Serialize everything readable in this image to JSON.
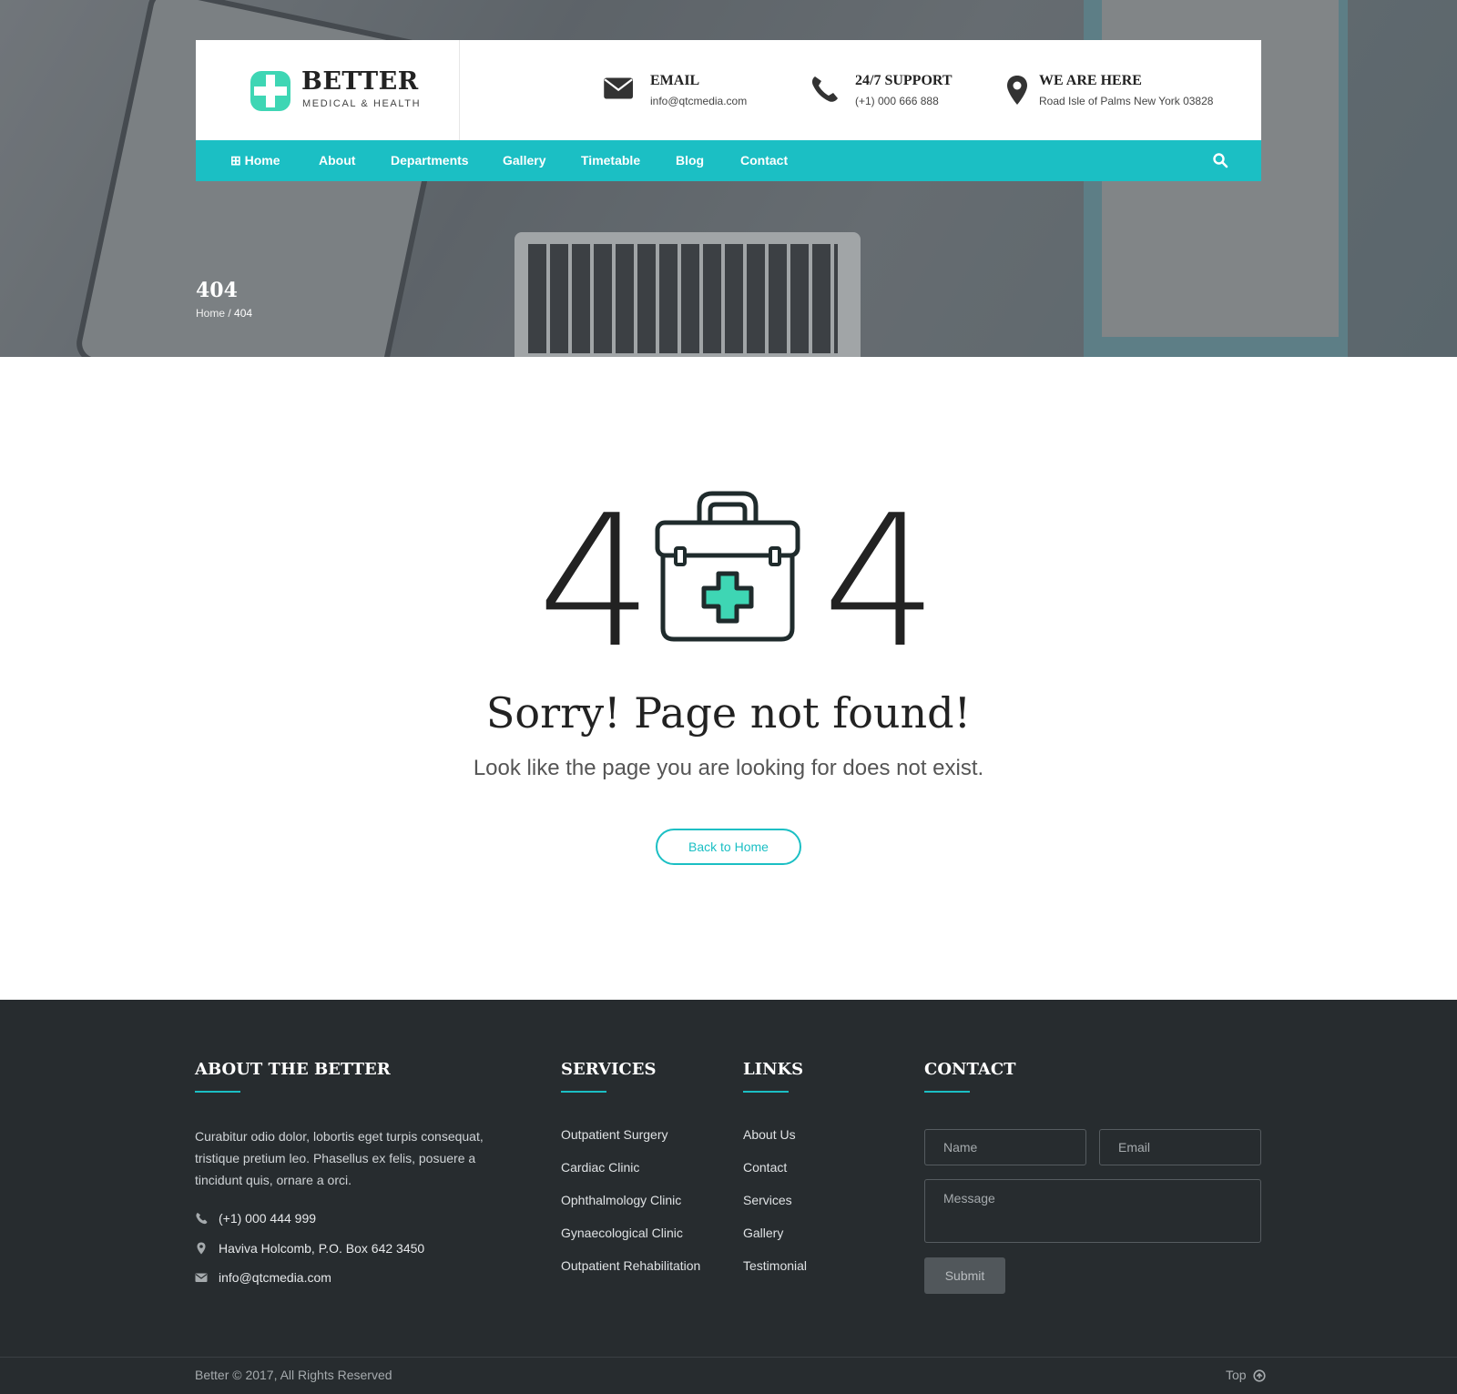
{
  "header": {
    "brand": {
      "name": "BETTER",
      "tagline": "MEDICAL & HEALTH",
      "accent_color": "#1bbfc4",
      "icon": "medical-cross-icon"
    },
    "info": [
      {
        "icon": "envelope-icon",
        "title": "EMAIL",
        "text": "info@qtcmedia.com"
      },
      {
        "icon": "phone-icon",
        "title": "24/7 SUPPORT",
        "text": "(+1) 000 666 888"
      },
      {
        "icon": "map-marker-icon",
        "title": "WE ARE HERE",
        "text": "Road Isle of Palms New York 03828"
      }
    ]
  },
  "nav": {
    "items": [
      {
        "label": "⊞ Home"
      },
      {
        "label": "About"
      },
      {
        "label": "Departments"
      },
      {
        "label": "Gallery"
      },
      {
        "label": "Timetable"
      },
      {
        "label": "Blog"
      },
      {
        "label": "Contact"
      }
    ],
    "search_icon": "search-icon"
  },
  "hero": {
    "title": "404",
    "breadcrumb": {
      "home": "Home",
      "sep": "/",
      "current": "404"
    }
  },
  "error": {
    "digit_left": "4",
    "digit_right": "4",
    "icon": "first-aid-kit-icon",
    "heading": "Sorry! Page not found!",
    "subheading": "Look like the page you are looking for does not exist.",
    "button": "Back to Home"
  },
  "footer": {
    "about": {
      "heading": "ABOUT THE BETTER",
      "text": "Curabitur odio dolor, lobortis eget turpis consequat, tristique pretium leo. Phasellus ex felis, posuere a tincidunt quis, ornare a orci.",
      "phone": "(+1) 000 444 999",
      "address": "Haviva Holcomb, P.O. Box 642 3450",
      "email": "info@qtcmedia.com"
    },
    "services": {
      "heading": "SERVICES",
      "items": [
        "Outpatient Surgery",
        "Cardiac Clinic",
        "Ophthalmology Clinic",
        "Gynaecological Clinic",
        "Outpatient Rehabilitation"
      ]
    },
    "links": {
      "heading": "LINKS",
      "items": [
        "About Us",
        "Contact",
        "Services",
        "Gallery",
        "Testimonial"
      ]
    },
    "contact": {
      "heading": "CONTACT",
      "name_placeholder": "Name",
      "email_placeholder": "Email",
      "message_placeholder": "Message",
      "submit": "Submit"
    },
    "copyright": "Better © 2017, All Rights Reserved",
    "top": "Top"
  }
}
